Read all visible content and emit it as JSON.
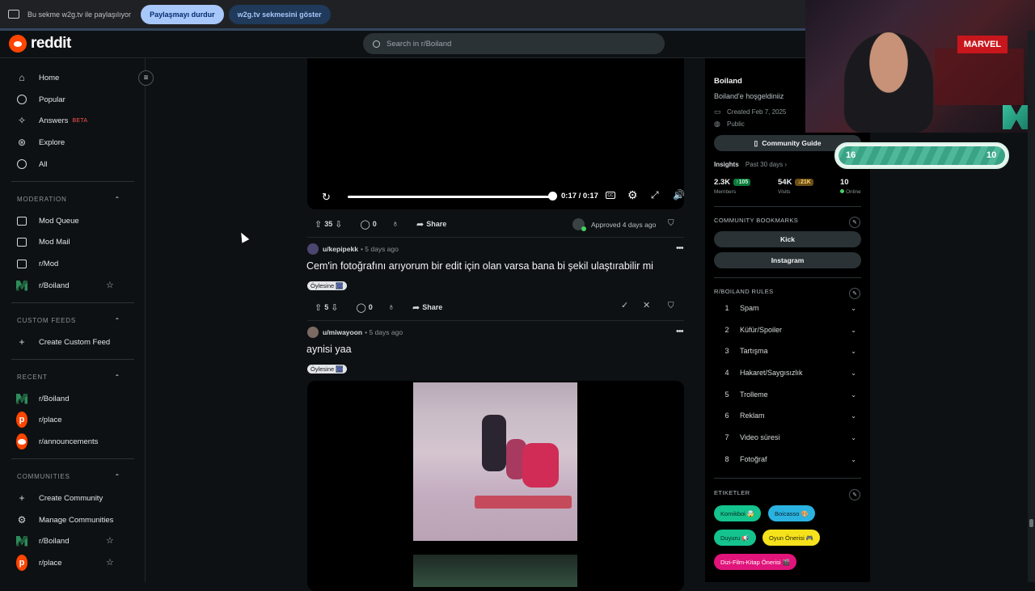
{
  "tab_share": {
    "message": "Bu sekme w2g.tv ile paylaşılıyor",
    "stop_label": "Paylaşmayı durdur",
    "show_label": "w2g.tv sekmesini göster"
  },
  "header": {
    "logo_text": "reddit",
    "search_placeholder": "Search in r/Boiland"
  },
  "sidebar": {
    "main": [
      {
        "label": "Home",
        "icon": "home-icon"
      },
      {
        "label": "Popular",
        "icon": "popular-icon"
      },
      {
        "label": "Answers",
        "icon": "answers-icon",
        "badge": "BETA"
      },
      {
        "label": "Explore",
        "icon": "explore-icon"
      },
      {
        "label": "All",
        "icon": "all-icon"
      }
    ],
    "moderation_title": "MODERATION",
    "moderation": [
      {
        "label": "Mod Queue"
      },
      {
        "label": "Mod Mail"
      },
      {
        "label": "r/Mod"
      },
      {
        "label": "r/Boiland"
      }
    ],
    "custom_feeds_title": "CUSTOM FEEDS",
    "create_custom_feed": "Create Custom Feed",
    "recent_title": "RECENT",
    "recent": [
      {
        "label": "r/Boiland"
      },
      {
        "label": "r/place"
      },
      {
        "label": "r/announcements"
      }
    ],
    "communities_title": "COMMUNITIES",
    "create_community": "Create Community",
    "manage_communities": "Manage Communities",
    "communities": [
      {
        "label": "r/Boiland"
      },
      {
        "label": "r/place"
      }
    ]
  },
  "video": {
    "time": "0:17 / 0:17",
    "progress": 1.0
  },
  "posts": [
    {
      "votes": "35",
      "comments": "0",
      "share": "Share",
      "approved": "Approved 4 days ago"
    },
    {
      "user": "u/kepipekk",
      "age": "5 days ago",
      "title": "Cem'in fotoğrafını arıyorum bir edit için olan varsa bana bi şekil ulaştırabilir mi",
      "flair": "Öylesine 🎆",
      "votes": "5",
      "comments": "0",
      "share": "Share"
    },
    {
      "user": "u/miwayoon",
      "age": "5 days ago",
      "title": "aynisi yaa",
      "flair": "Öylesine 🎆"
    }
  ],
  "community": {
    "name": "Boiland",
    "description": "Boiland'e hoşgeldiniiz",
    "created": "Created Feb 7, 2025",
    "visibility": "Public",
    "guide_button": "Community Guide",
    "insights_label": "Insights",
    "insights_period": "Past 30 days ›",
    "members_value": "2.3K",
    "members_delta": "↑105",
    "members_label": "Members",
    "visits_value": "54K",
    "visits_delta": "↓21K",
    "visits_label": "Visits",
    "online_value": "10",
    "online_label": "Online",
    "bookmarks_title": "COMMUNITY BOOKMARKS",
    "bookmarks": [
      "Kick",
      "Instagram"
    ],
    "rules_title": "R/BOILAND RULES",
    "rules": [
      {
        "n": "1",
        "t": "Spam"
      },
      {
        "n": "2",
        "t": "Küfür/Spoiler"
      },
      {
        "n": "3",
        "t": "Tartışma"
      },
      {
        "n": "4",
        "t": "Hakaret/Saygısızlık"
      },
      {
        "n": "5",
        "t": "Trolleme"
      },
      {
        "n": "6",
        "t": "Reklam"
      },
      {
        "n": "7",
        "t": "Video süresi"
      },
      {
        "n": "8",
        "t": "Fotoğraf"
      }
    ],
    "tags_title": "ETIKETLER",
    "tags": [
      {
        "label": "Komikboi 🤯",
        "bg": "#14c38e",
        "fg": "#0b2b22"
      },
      {
        "label": "Boicasso 🎨",
        "bg": "#2ab3e0",
        "fg": "#0b2230"
      },
      {
        "label": "Duyuru 📢",
        "bg": "#14c38e",
        "fg": "#0b2b22"
      },
      {
        "label": "Oyun Önerisi 🎮",
        "bg": "#f5e21b",
        "fg": "#2a2600"
      },
      {
        "label": "Dizi-Film-Kitap Önerisi 🎬",
        "bg": "#e0147a",
        "fg": "#ffffff"
      }
    ]
  },
  "stream_overlay": {
    "left_score": "16",
    "right_score": "10",
    "sign_text": "MARVEL"
  },
  "colors": {
    "accent": "#ff4500",
    "background": "#0e1113",
    "online": "#46d160"
  }
}
